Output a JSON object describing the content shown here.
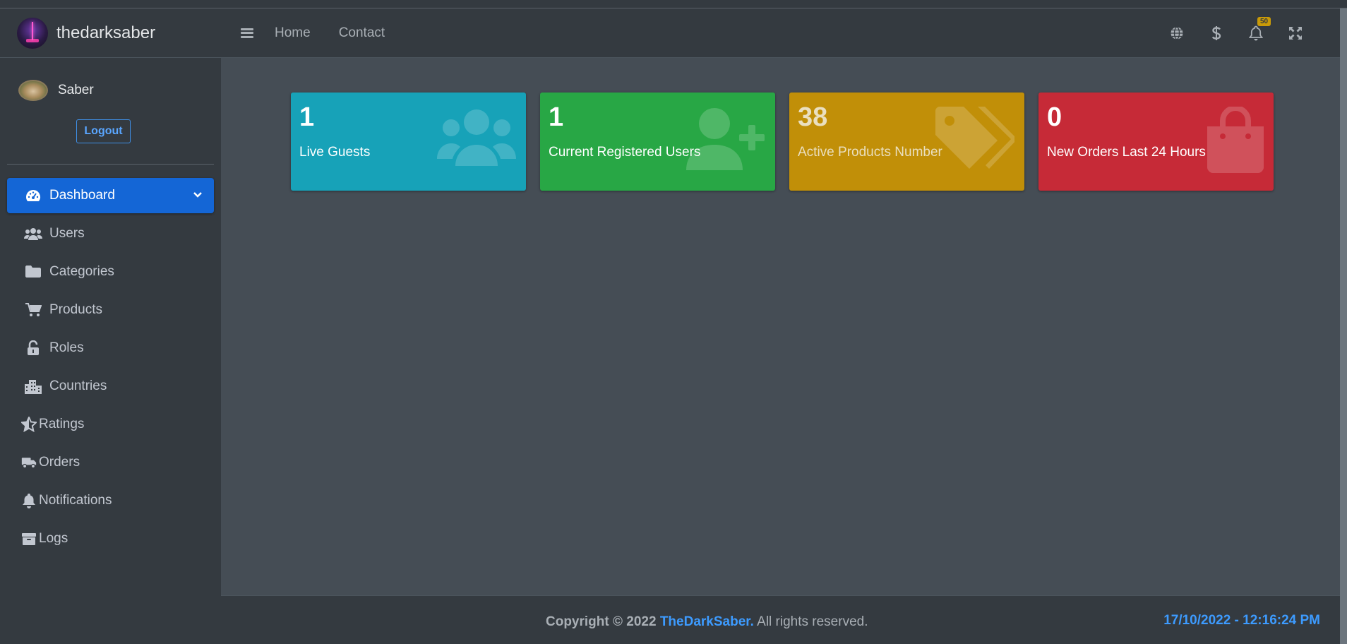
{
  "brand": {
    "name": "thedarksaber",
    "logo_icon": "lightsaber-logo-icon"
  },
  "user": {
    "name": "Saber",
    "logout_label": "Logout"
  },
  "sidebar": {
    "items": [
      {
        "label": "Dashboard",
        "icon": "gauge-icon",
        "active": true
      },
      {
        "label": "Users",
        "icon": "users-icon"
      },
      {
        "label": "Categories",
        "icon": "folder-icon"
      },
      {
        "label": "Products",
        "icon": "cart-icon"
      },
      {
        "label": "Roles",
        "icon": "unlock-icon"
      },
      {
        "label": "Countries",
        "icon": "city-icon"
      },
      {
        "label": "Ratings",
        "icon": "star-icon"
      },
      {
        "label": "Orders",
        "icon": "truck-icon"
      },
      {
        "label": "Notifications",
        "icon": "bell-icon"
      },
      {
        "label": "Logs",
        "icon": "archive-icon"
      }
    ]
  },
  "header": {
    "nav": [
      "Home",
      "Contact"
    ],
    "icons": [
      "globe-icon",
      "dollar-icon",
      "bell-icon",
      "fullscreen-icon"
    ],
    "notification_count": "50"
  },
  "stats": [
    {
      "value": "1",
      "label": "Live Guests",
      "color": "#17a2b8",
      "icon": "users-icon"
    },
    {
      "value": "1",
      "label": "Current Registered Users",
      "color": "#28a745",
      "icon": "user-plus-icon"
    },
    {
      "value": "38",
      "label": "Active Products Number",
      "color": "#c18f08",
      "icon": "tags-icon"
    },
    {
      "value": "0",
      "label": "New Orders Last 24 Hours",
      "color": "#c62a37",
      "icon": "shopping-bag-icon"
    }
  ],
  "footer": {
    "copyright_prefix": "Copyright © 2022",
    "brand_link": "TheDarkSaber.",
    "suffix": "All rights reserved.",
    "clock": "17/10/2022 - 12:16:24 PM"
  }
}
